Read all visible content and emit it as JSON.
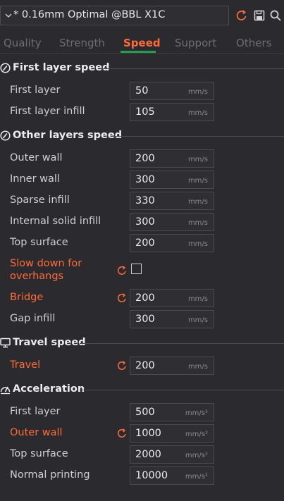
{
  "preset": {
    "name": "* 0.16mm Optimal @BBL X1C"
  },
  "tabs": [
    "Quality",
    "Strength",
    "Speed",
    "Support",
    "Others"
  ],
  "active_tab": "Speed",
  "colors": {
    "accent": "#ff6a38",
    "active_underline": "#1fa14a",
    "background": "#2b2b2f"
  },
  "sections": {
    "first_layer": {
      "title": "First layer speed",
      "rows": [
        {
          "label": "First layer",
          "value": "50",
          "unit": "mm/s"
        },
        {
          "label": "First layer infill",
          "value": "105",
          "unit": "mm/s"
        }
      ]
    },
    "other_layers": {
      "title": "Other layers speed",
      "rows": [
        {
          "label": "Outer wall",
          "value": "200",
          "unit": "mm/s"
        },
        {
          "label": "Inner wall",
          "value": "300",
          "unit": "mm/s"
        },
        {
          "label": "Sparse infill",
          "value": "330",
          "unit": "mm/s"
        },
        {
          "label": "Internal solid infill",
          "value": "300",
          "unit": "mm/s"
        },
        {
          "label": "Top surface",
          "value": "200",
          "unit": "mm/s"
        }
      ],
      "slow_down": {
        "label_line1": "Slow down for",
        "label_line2": "overhangs",
        "checked": false
      },
      "rows2": [
        {
          "label": "Bridge",
          "value": "200",
          "unit": "mm/s"
        },
        {
          "label": "Gap infill",
          "value": "300",
          "unit": "mm/s"
        }
      ]
    },
    "travel": {
      "title": "Travel speed",
      "rows": [
        {
          "label": "Travel",
          "value": "200",
          "unit": "mm/s"
        }
      ]
    },
    "acceleration": {
      "title": "Acceleration",
      "rows": [
        {
          "label": "First layer",
          "value": "500",
          "unit": "mm/s²"
        },
        {
          "label": "Outer wall",
          "value": "1000",
          "unit": "mm/s²"
        },
        {
          "label": "Top surface",
          "value": "2000",
          "unit": "mm/s²"
        },
        {
          "label": "Normal printing",
          "value": "10000",
          "unit": "mm/s²"
        }
      ]
    }
  }
}
